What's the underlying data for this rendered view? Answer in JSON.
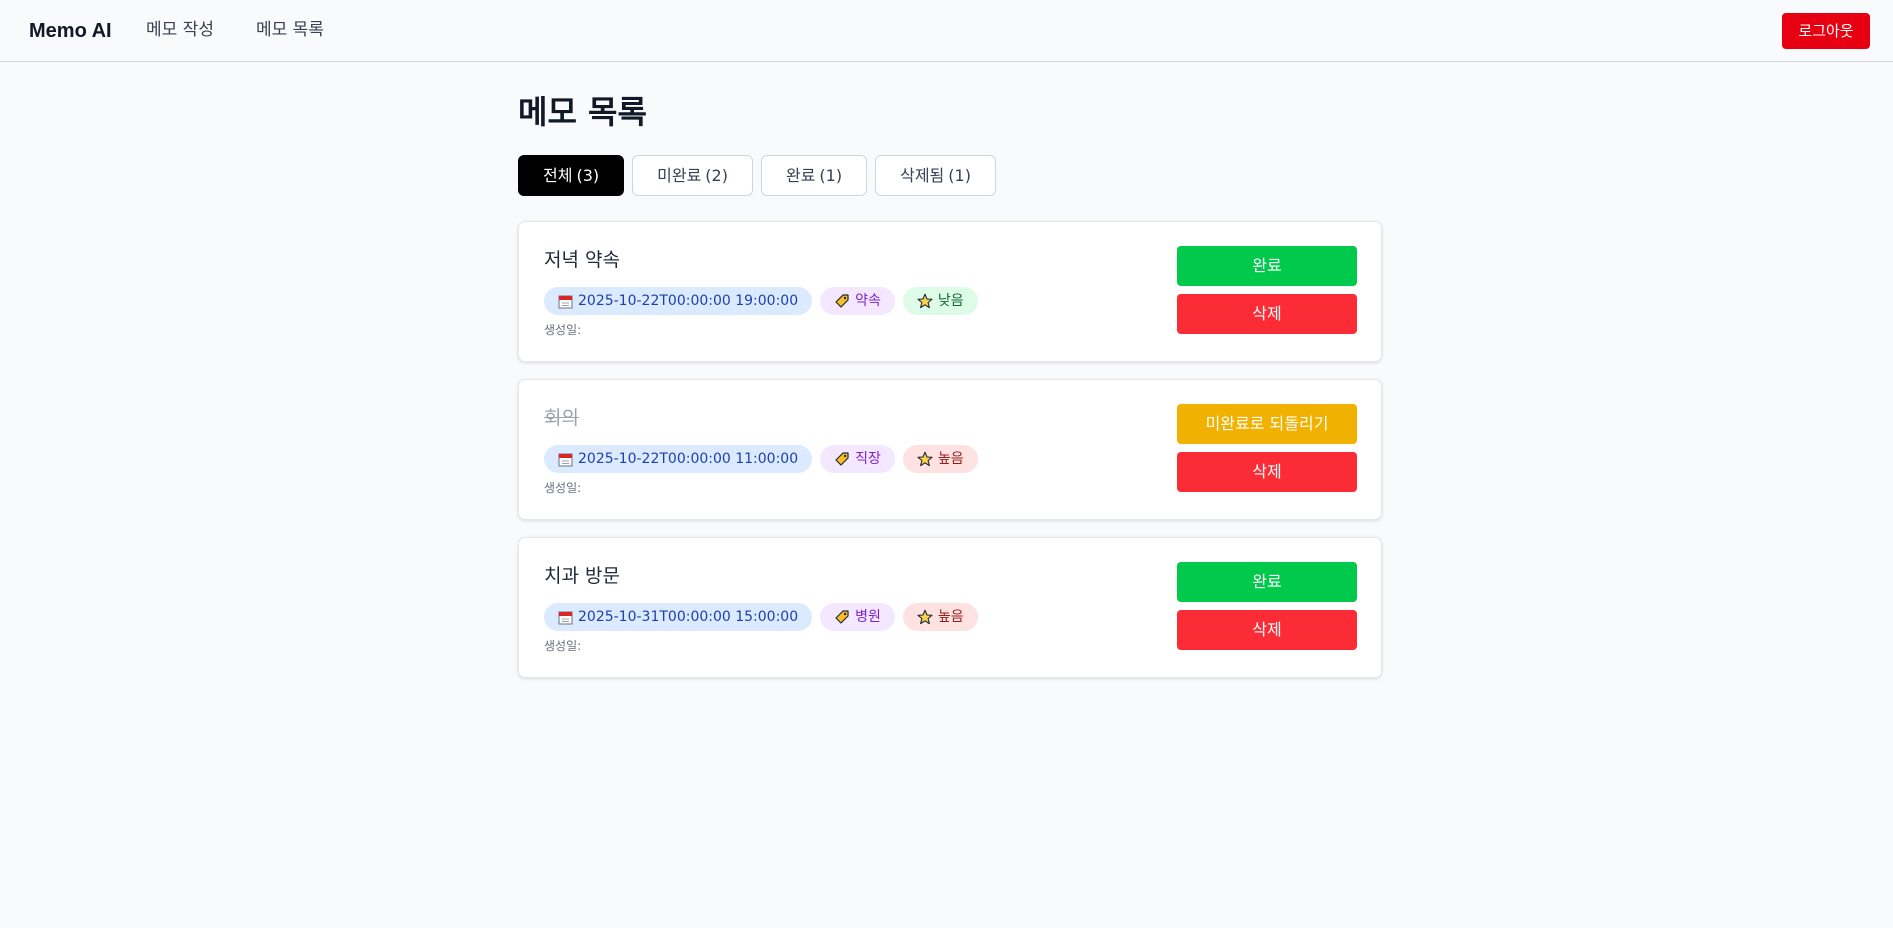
{
  "nav": {
    "brand": "Memo AI",
    "links": [
      "메모 작성",
      "메모 목록"
    ],
    "logout_label": "로그아웃"
  },
  "page": {
    "title": "메모 목록"
  },
  "tabs": [
    {
      "label": "전체",
      "count": "(3)",
      "active": true
    },
    {
      "label": "미완료",
      "count": "(2)",
      "active": false
    },
    {
      "label": "완료",
      "count": "(1)",
      "active": false
    },
    {
      "label": "삭제됨",
      "count": "(1)",
      "active": false
    }
  ],
  "memos": [
    {
      "title": "저녁 약속",
      "done": false,
      "datetime": "2025-10-22T00:00:00 19:00:00",
      "category": "약속",
      "priority": "낮음",
      "priority_level": "low",
      "created_label": "생성일:",
      "primary_action": "완료",
      "delete_label": "삭제"
    },
    {
      "title": "회의",
      "done": true,
      "datetime": "2025-10-22T00:00:00 11:00:00",
      "category": "직장",
      "priority": "높음",
      "priority_level": "high",
      "created_label": "생성일:",
      "primary_action": "미완료로 되돌리기",
      "delete_label": "삭제"
    },
    {
      "title": "치과 방문",
      "done": false,
      "datetime": "2025-10-31T00:00:00 15:00:00",
      "category": "병원",
      "priority": "높음",
      "priority_level": "high",
      "created_label": "생성일:",
      "primary_action": "완료",
      "delete_label": "삭제"
    }
  ],
  "icons": {
    "date": "calendar-icon",
    "category": "tag-icon",
    "priority": "star-icon"
  },
  "colors": {
    "logout": "#e60012",
    "complete": "#00c94b",
    "revert": "#f0b100",
    "delete": "#fb2c36",
    "active_tab": "#000000"
  }
}
